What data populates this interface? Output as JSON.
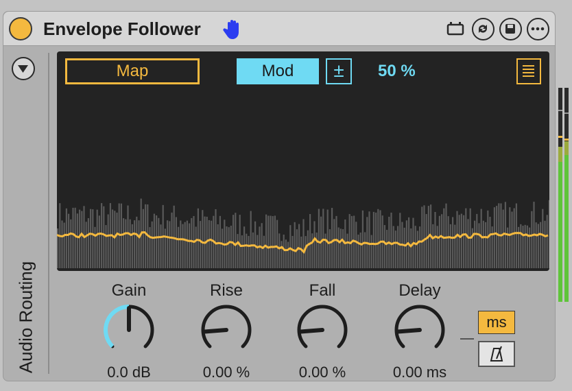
{
  "device": {
    "title": "Envelope Follower",
    "accent_color": "#f4b93f",
    "mod_color": "#6fdaf3",
    "header_icons": [
      "clip-icon",
      "hot-swap-icon",
      "save-preset-icon",
      "more-options-icon"
    ]
  },
  "sidebar": {
    "label": "Audio Routing"
  },
  "display": {
    "map_label": "Map",
    "mod_label": "Mod",
    "bipolar_symbol": "±",
    "depth_value": "50 %"
  },
  "knobs": [
    {
      "label": "Gain",
      "value": "0.0 dB",
      "level": 0.5
    },
    {
      "label": "Rise",
      "value": "0.00 %",
      "level": 0.15
    },
    {
      "label": "Fall",
      "value": "0.00 %",
      "level": 0.15
    },
    {
      "label": "Delay",
      "value": "0.00 ms",
      "level": 0.15
    }
  ],
  "delay_mode": {
    "ms_label": "ms",
    "sync_icon": "metronome-icon"
  }
}
